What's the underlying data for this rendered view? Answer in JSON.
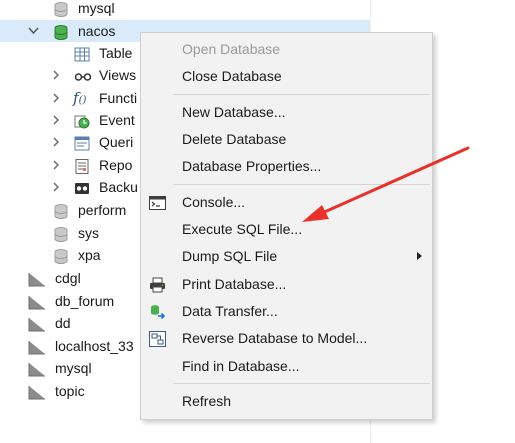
{
  "tree": {
    "items": [
      {
        "label": "mysql"
      },
      {
        "label": "nacos"
      },
      {
        "label": "Table"
      },
      {
        "label": "Views"
      },
      {
        "label": "Functi"
      },
      {
        "label": "Event"
      },
      {
        "label": "Queri"
      },
      {
        "label": "Repo"
      },
      {
        "label": "Backu"
      },
      {
        "label": "perform"
      },
      {
        "label": "sys"
      },
      {
        "label": "xpa"
      },
      {
        "label": "cdgl"
      },
      {
        "label": "db_forum"
      },
      {
        "label": "dd"
      },
      {
        "label": "localhost_33"
      },
      {
        "label": "mysql"
      },
      {
        "label": "topic"
      }
    ]
  },
  "context_menu": {
    "items": [
      {
        "label": "Open Database",
        "enabled": false
      },
      {
        "label": "Close Database",
        "enabled": true
      },
      {
        "label": "New Database...",
        "enabled": true
      },
      {
        "label": "Delete Database",
        "enabled": true
      },
      {
        "label": "Database Properties...",
        "enabled": true
      },
      {
        "label": "Console...",
        "enabled": true,
        "icon": "console-icon"
      },
      {
        "label": "Execute SQL File...",
        "enabled": true
      },
      {
        "label": "Dump SQL File",
        "enabled": true,
        "submenu": true
      },
      {
        "label": "Print Database...",
        "enabled": true,
        "icon": "printer-icon"
      },
      {
        "label": "Data Transfer...",
        "enabled": true,
        "icon": "data-transfer-icon"
      },
      {
        "label": "Reverse Database to Model...",
        "enabled": true,
        "icon": "reverse-model-icon"
      },
      {
        "label": "Find in Database...",
        "enabled": true
      },
      {
        "label": "Refresh",
        "enabled": true
      }
    ]
  },
  "colors": {
    "selection": "#d9ebfa",
    "menu_bg": "#f2f2f2",
    "annotation_arrow": "#e8312b"
  }
}
